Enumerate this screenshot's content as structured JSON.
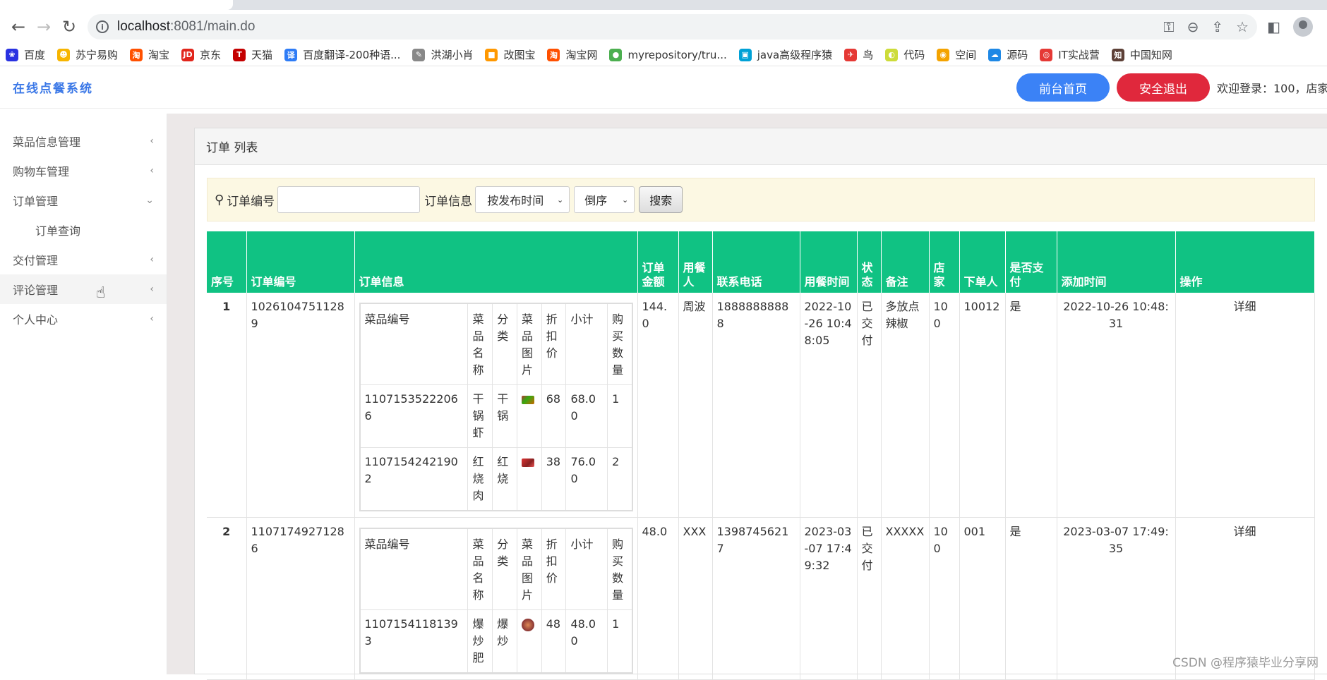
{
  "browser": {
    "url_host": "localhost",
    "url_rest": ":8081/main.do",
    "bookmarks": [
      {
        "label": "百度",
        "color": "#2932e1",
        "glyph": "❀"
      },
      {
        "label": "苏宁易购",
        "color": "#f7b500",
        "glyph": "☻"
      },
      {
        "label": "淘宝",
        "color": "#ff5000",
        "glyph": "淘"
      },
      {
        "label": "京东",
        "color": "#e1251b",
        "glyph": "JD"
      },
      {
        "label": "天猫",
        "color": "#c40000",
        "glyph": "T"
      },
      {
        "label": "百度翻译-200种语...",
        "color": "#2e7cf6",
        "glyph": "译"
      },
      {
        "label": "洪湖小肖",
        "color": "#888888",
        "glyph": "✎"
      },
      {
        "label": "改图宝",
        "color": "#ff9800",
        "glyph": "■"
      },
      {
        "label": "淘宝网",
        "color": "#ff5000",
        "glyph": "淘"
      },
      {
        "label": "myrepository/tru...",
        "color": "#4caf50",
        "glyph": "●"
      },
      {
        "label": "java高级程序猿",
        "color": "#00a1d6",
        "glyph": "▣"
      },
      {
        "label": "鸟",
        "color": "#e53935",
        "glyph": "✈"
      },
      {
        "label": "代码",
        "color": "#cddc39",
        "glyph": "◐"
      },
      {
        "label": "空间",
        "color": "#f4a300",
        "glyph": "◉"
      },
      {
        "label": "源码",
        "color": "#1e88e5",
        "glyph": "☁"
      },
      {
        "label": "IT实战营",
        "color": "#e53935",
        "glyph": "◎"
      },
      {
        "label": "中国知网",
        "color": "#5d4037",
        "glyph": "知"
      }
    ]
  },
  "header": {
    "title": "在线点餐系统",
    "home_button": "前台首页",
    "logout_button": "安全退出",
    "welcome": "欢迎登录：100，店家"
  },
  "sidebar": {
    "items": [
      {
        "label": "菜品信息管理",
        "chevron": "‹"
      },
      {
        "label": "购物车管理",
        "chevron": "‹"
      },
      {
        "label": "订单管理",
        "chevron": "⌄"
      },
      {
        "label": "订单查询",
        "sub": true
      },
      {
        "label": "交付管理",
        "chevron": "‹"
      },
      {
        "label": "评论管理",
        "chevron": "‹"
      },
      {
        "label": "个人中心",
        "chevron": "‹"
      }
    ]
  },
  "panel": {
    "title": "订单 列表",
    "search": {
      "order_no_label": "订单编号",
      "order_no_value": "",
      "order_info_label": "订单信息",
      "sort_field": "按发布时间",
      "sort_order": "倒序",
      "search_button": "搜索"
    }
  },
  "table": {
    "headers": [
      "序号",
      "订单编号",
      "订单信息",
      "订单金额",
      "用餐人",
      "联系电话",
      "用餐时间",
      "状态",
      "备注",
      "店家",
      "下单人",
      "是否支付",
      "添加时间",
      "操作"
    ],
    "inner_headers": [
      "菜品编号",
      "菜品名称",
      "分类",
      "菜品图片",
      "折扣价",
      "小计",
      "购买数量"
    ],
    "rows": [
      {
        "index": "1",
        "order_no": "10261047511289",
        "amount": "144.0",
        "diner": "周波",
        "phone": "18888888888",
        "meal_time": "2022-10-26 10:48:05",
        "status": "已交付",
        "remark": "多放点辣椒",
        "shop": "100",
        "orderer": "10012",
        "paid": "是",
        "added": "2022-10-26 10:48:31",
        "action": "详细",
        "items": [
          {
            "code": "11071535222066",
            "name": "干锅虾",
            "category": "干锅",
            "price": "68",
            "subtotal": "68.00",
            "qty": "1",
            "img": "t1"
          },
          {
            "code": "11071542421902",
            "name": "红烧肉",
            "category": "红烧",
            "price": "38",
            "subtotal": "76.00",
            "qty": "2",
            "img": "t2"
          }
        ]
      },
      {
        "index": "2",
        "order_no": "11071749271286",
        "amount": "48.0",
        "diner": "XXX",
        "phone": "13987456217",
        "meal_time": "2023-03-07 17:49:32",
        "status": "已交付",
        "remark": "XXXXX",
        "shop": "100",
        "orderer": "001",
        "paid": "是",
        "added": "2023-03-07 17:49:35",
        "action": "详细",
        "items": [
          {
            "code": "11071541181393",
            "name": "爆炒肥",
            "category": "爆炒",
            "price": "48",
            "subtotal": "48.00",
            "qty": "1",
            "img": "t3"
          }
        ]
      }
    ]
  },
  "watermark": "CSDN @程序猿毕业分享网"
}
